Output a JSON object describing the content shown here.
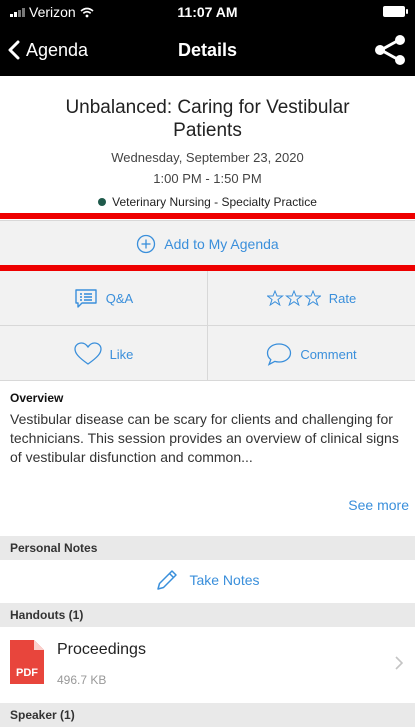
{
  "status_bar": {
    "carrier": "Verizon",
    "time": "11:07 AM"
  },
  "nav": {
    "back_label": "Agenda",
    "title": "Details"
  },
  "session": {
    "title": "Unbalanced:  Caring for Vestibular Patients",
    "date": "Wednesday, September 23, 2020",
    "time": "1:00 PM - 1:50 PM",
    "track": "Veterinary Nursing - Specialty Practice",
    "track_color": "#1f5a4b"
  },
  "actions": {
    "add_agenda": "Add to My Agenda",
    "qa": "Q&A",
    "rate": "Rate",
    "like": "Like",
    "comment": "Comment"
  },
  "overview": {
    "heading": "Overview",
    "text": "Vestibular disease can be scary for clients and challenging for technicians. This session provides an overview of clinical signs of vestibular disfunction and common...",
    "see_more": "See more"
  },
  "notes": {
    "heading": "Personal Notes",
    "take_notes": "Take Notes"
  },
  "handouts": {
    "heading": "Handouts (1)",
    "items": [
      {
        "icon_label": "PDF",
        "name": "Proceedings",
        "size": "496.7 KB"
      }
    ]
  },
  "speaker": {
    "heading": "Speaker (1)"
  },
  "colors": {
    "accent": "#3a8fdb",
    "highlight": "#ee0000",
    "pdf": "#e8453c"
  }
}
